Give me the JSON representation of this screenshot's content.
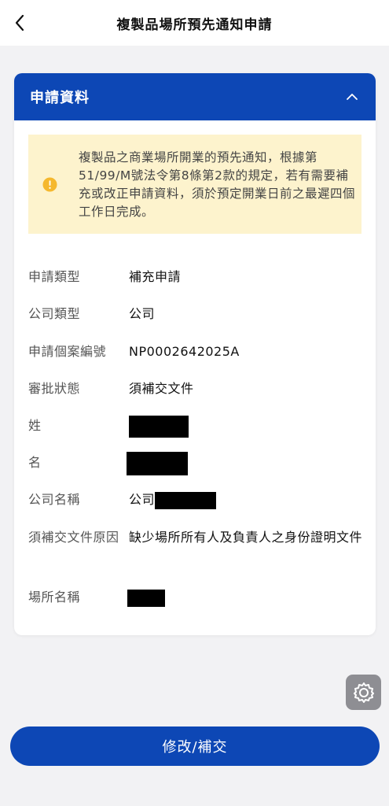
{
  "header": {
    "title": "複製品場所預先通知申請",
    "back_icon": "chevron-left-icon"
  },
  "card": {
    "title": "申請資料",
    "collapse_icon": "chevron-up-icon",
    "notice": {
      "icon": "warning-icon",
      "text": "複製品之商業場所開業的預先通知，根據第51/99/M號法令第8條第2款的規定，若有需要補充或改正申請資料，須於預定開業日前之最遲四個工作日完成。"
    },
    "fields": [
      {
        "label": "申請類型",
        "value": "補充申請"
      },
      {
        "label": "公司類型",
        "value": "公司"
      },
      {
        "label": "申請個案編號",
        "value": "NP0002642025A"
      },
      {
        "label": "審批狀態",
        "value": "須補交文件"
      },
      {
        "label": "姓",
        "value": ""
      },
      {
        "label": "名",
        "value": ""
      },
      {
        "label": "公司名稱",
        "value": "公司"
      },
      {
        "label": "須補交文件原因",
        "value": "缺少場所所有人及負責人之身份證明文件"
      },
      {
        "label": "場所名稱",
        "value": ""
      }
    ]
  },
  "floating": {
    "settings_icon": "gear-icon"
  },
  "footer": {
    "submit_label": "修改/補交"
  },
  "colors": {
    "primary": "#0d47b5",
    "notice_bg": "#fdf3cd",
    "notice_icon": "#f5b82e",
    "page_bg": "#f2f2f4"
  }
}
